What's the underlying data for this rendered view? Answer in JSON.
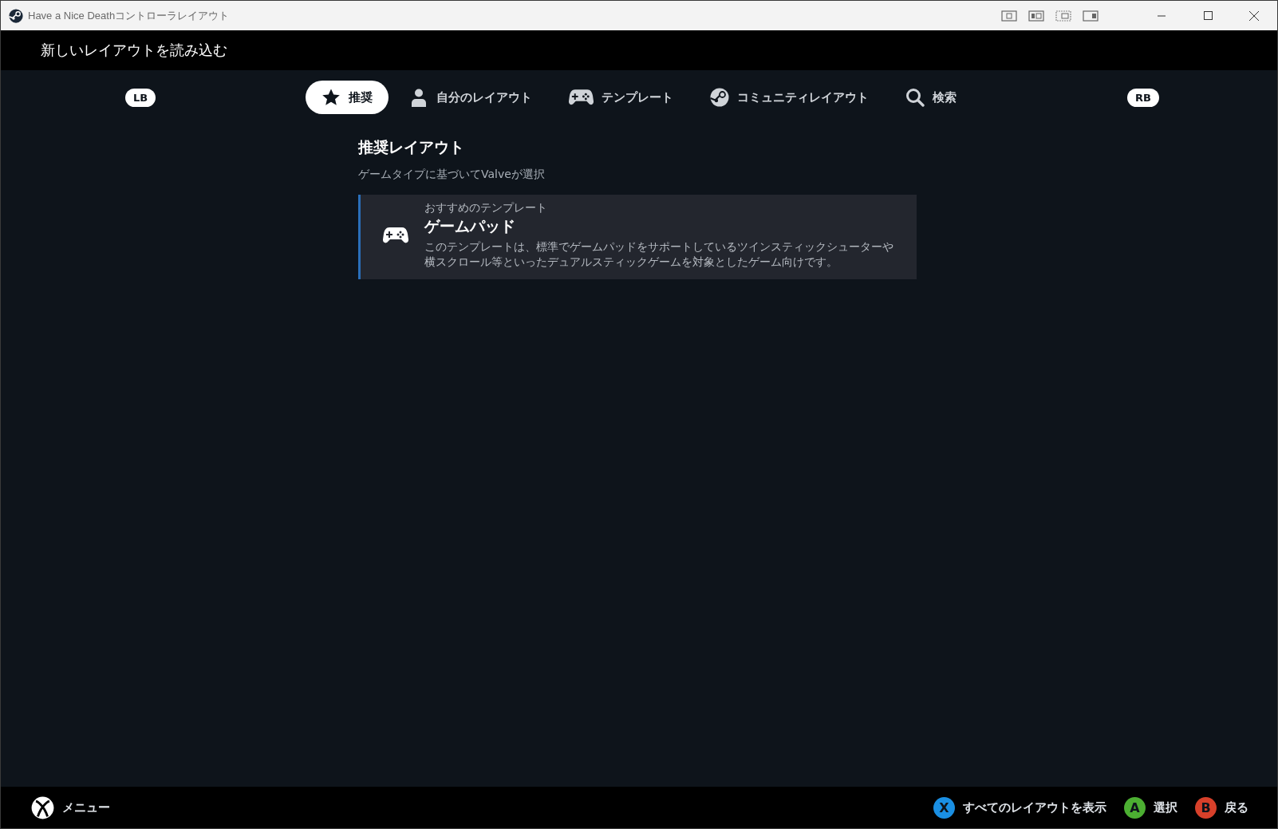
{
  "window": {
    "title": "Have a Nice Deathコントローラレイアウト"
  },
  "header": {
    "title": "新しいレイアウトを読み込む"
  },
  "bumpers": {
    "left": "LB",
    "right": "RB"
  },
  "tabs": [
    {
      "label": "推奨",
      "kind": "star",
      "selected": true
    },
    {
      "label": "自分のレイアウト",
      "kind": "person",
      "selected": false
    },
    {
      "label": "テンプレート",
      "kind": "gamepad",
      "selected": false
    },
    {
      "label": "コミュニティレイアウト",
      "kind": "steam",
      "selected": false
    },
    {
      "label": "検索",
      "kind": "search",
      "selected": false
    }
  ],
  "section": {
    "title": "推奨レイアウト",
    "subtitle": "ゲームタイプに基づいてValveが選択"
  },
  "cards": [
    {
      "eyebrow": "おすすめのテンプレート",
      "title": "ゲームパッド",
      "description": "このテンプレートは、標準でゲームパッドをサポートしているツインスティックシューターや横スクロール等といったデュアルスティックゲームを対象としたゲーム向けです。",
      "selected": true
    }
  ],
  "footer": {
    "menu": "メニュー",
    "actions": [
      {
        "key": "X",
        "label": "すべてのレイアウトを表示",
        "color": "#1a8fe3"
      },
      {
        "key": "A",
        "label": "選択",
        "color": "#4caf32"
      },
      {
        "key": "B",
        "label": "戻る",
        "color": "#d7402a"
      }
    ]
  }
}
